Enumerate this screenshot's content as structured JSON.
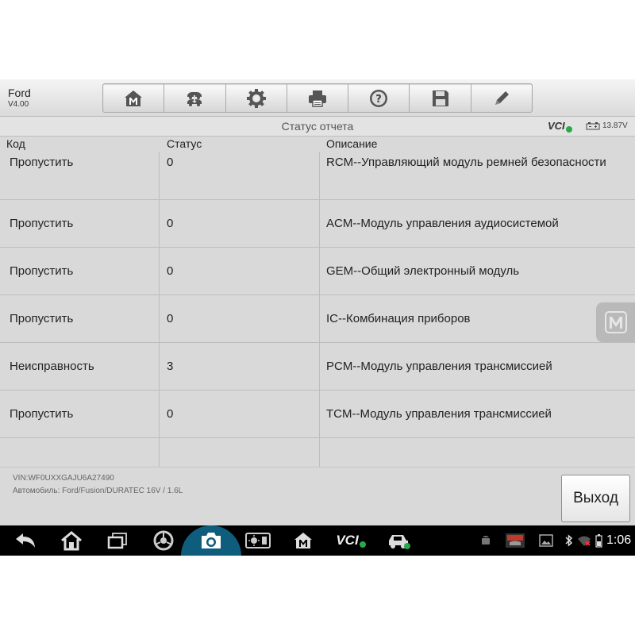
{
  "app": {
    "brand": "Ford",
    "version": "V4.00"
  },
  "toolbar": {
    "buttons": [
      {
        "icon": "home-icon"
      },
      {
        "icon": "vehicle-swap-icon"
      },
      {
        "icon": "settings-gear-icon"
      },
      {
        "icon": "printer-icon"
      },
      {
        "icon": "help-icon"
      },
      {
        "icon": "save-icon"
      },
      {
        "icon": "pencil-icon"
      }
    ]
  },
  "status_bar": {
    "title": "Статус отчета",
    "vci_label": "VCI",
    "voltage": "13.87V"
  },
  "table": {
    "headers": [
      "Код",
      "Статус",
      "Описание"
    ],
    "rows": [
      {
        "code": "Пропустить",
        "status": "0",
        "description": "RCM--Управляющий модуль ремней безопасности"
      },
      {
        "code": "Пропустить",
        "status": "0",
        "description": "ACM--Модуль управления аудиосистемой"
      },
      {
        "code": "Пропустить",
        "status": "0",
        "description": "GEM--Общий электронный модуль"
      },
      {
        "code": "Пропустить",
        "status": "0",
        "description": "IC--Комбинация приборов"
      },
      {
        "code": "Неисправность",
        "status": "3",
        "description": "PCM--Модуль управления трансмиссией"
      },
      {
        "code": "Пропустить",
        "status": "0",
        "description": "TCM--Модуль управления трансмиссией"
      },
      {
        "code": "",
        "status": "",
        "description": ""
      }
    ]
  },
  "footer": {
    "vin": "VIN:WF0UXXGAJU6A27490",
    "vehicle": "Автомобиль: Ford/Fusion/DURATEC 16V / 1.6L",
    "exit_label": "Выход"
  },
  "navbar": {
    "vci_label": "VCI",
    "time": "1:06",
    "colors": {
      "background": "#000000",
      "camera_highlight": "#0e5d7c"
    }
  }
}
